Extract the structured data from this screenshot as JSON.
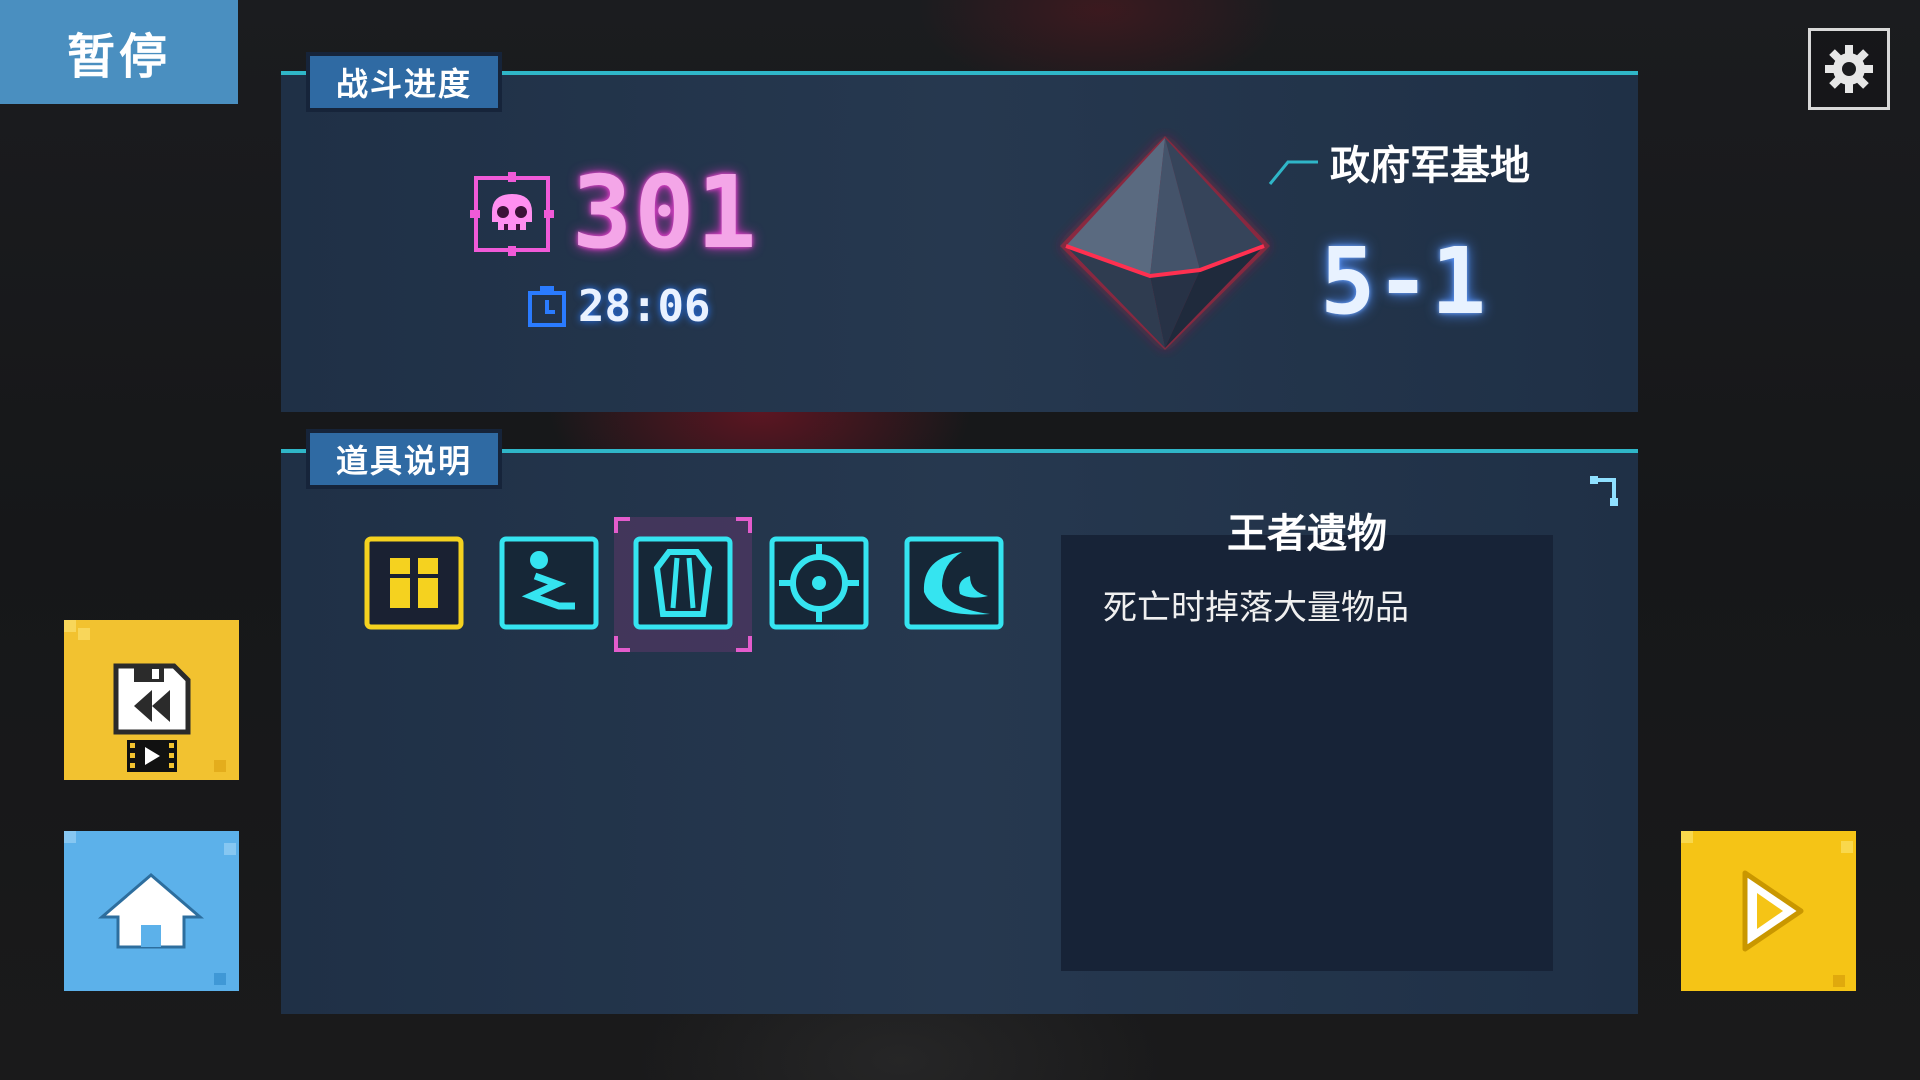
{
  "title": "暂停",
  "settings": {
    "icon": "gear-icon"
  },
  "battle_panel": {
    "tab_label": "战斗进度",
    "kill_count": "301",
    "timer": "28:06",
    "location": "政府军基地",
    "stage": "5-1"
  },
  "items_panel": {
    "tab_label": "道具说明",
    "items": [
      {
        "icon": "gift-box-icon",
        "color": "#f5d21f",
        "selected": false
      },
      {
        "icon": "zigzag-path-icon",
        "color": "#35e4f0",
        "selected": false
      },
      {
        "icon": "coffin-icon",
        "color": "#35e4f0",
        "selected": true
      },
      {
        "icon": "crosshair-icon",
        "color": "#35e4f0",
        "selected": false
      },
      {
        "icon": "crescent-wave-icon",
        "color": "#35e4f0",
        "selected": false
      }
    ],
    "selected_title": "王者遗物",
    "selected_desc": "死亡时掉落大量物品"
  },
  "buttons": {
    "replay": {
      "icon": "rewind-save-icon",
      "color": "#f2c230"
    },
    "home": {
      "icon": "home-icon",
      "color": "#5cb1ea"
    },
    "resume": {
      "icon": "play-icon",
      "color": "#f5c416"
    }
  }
}
